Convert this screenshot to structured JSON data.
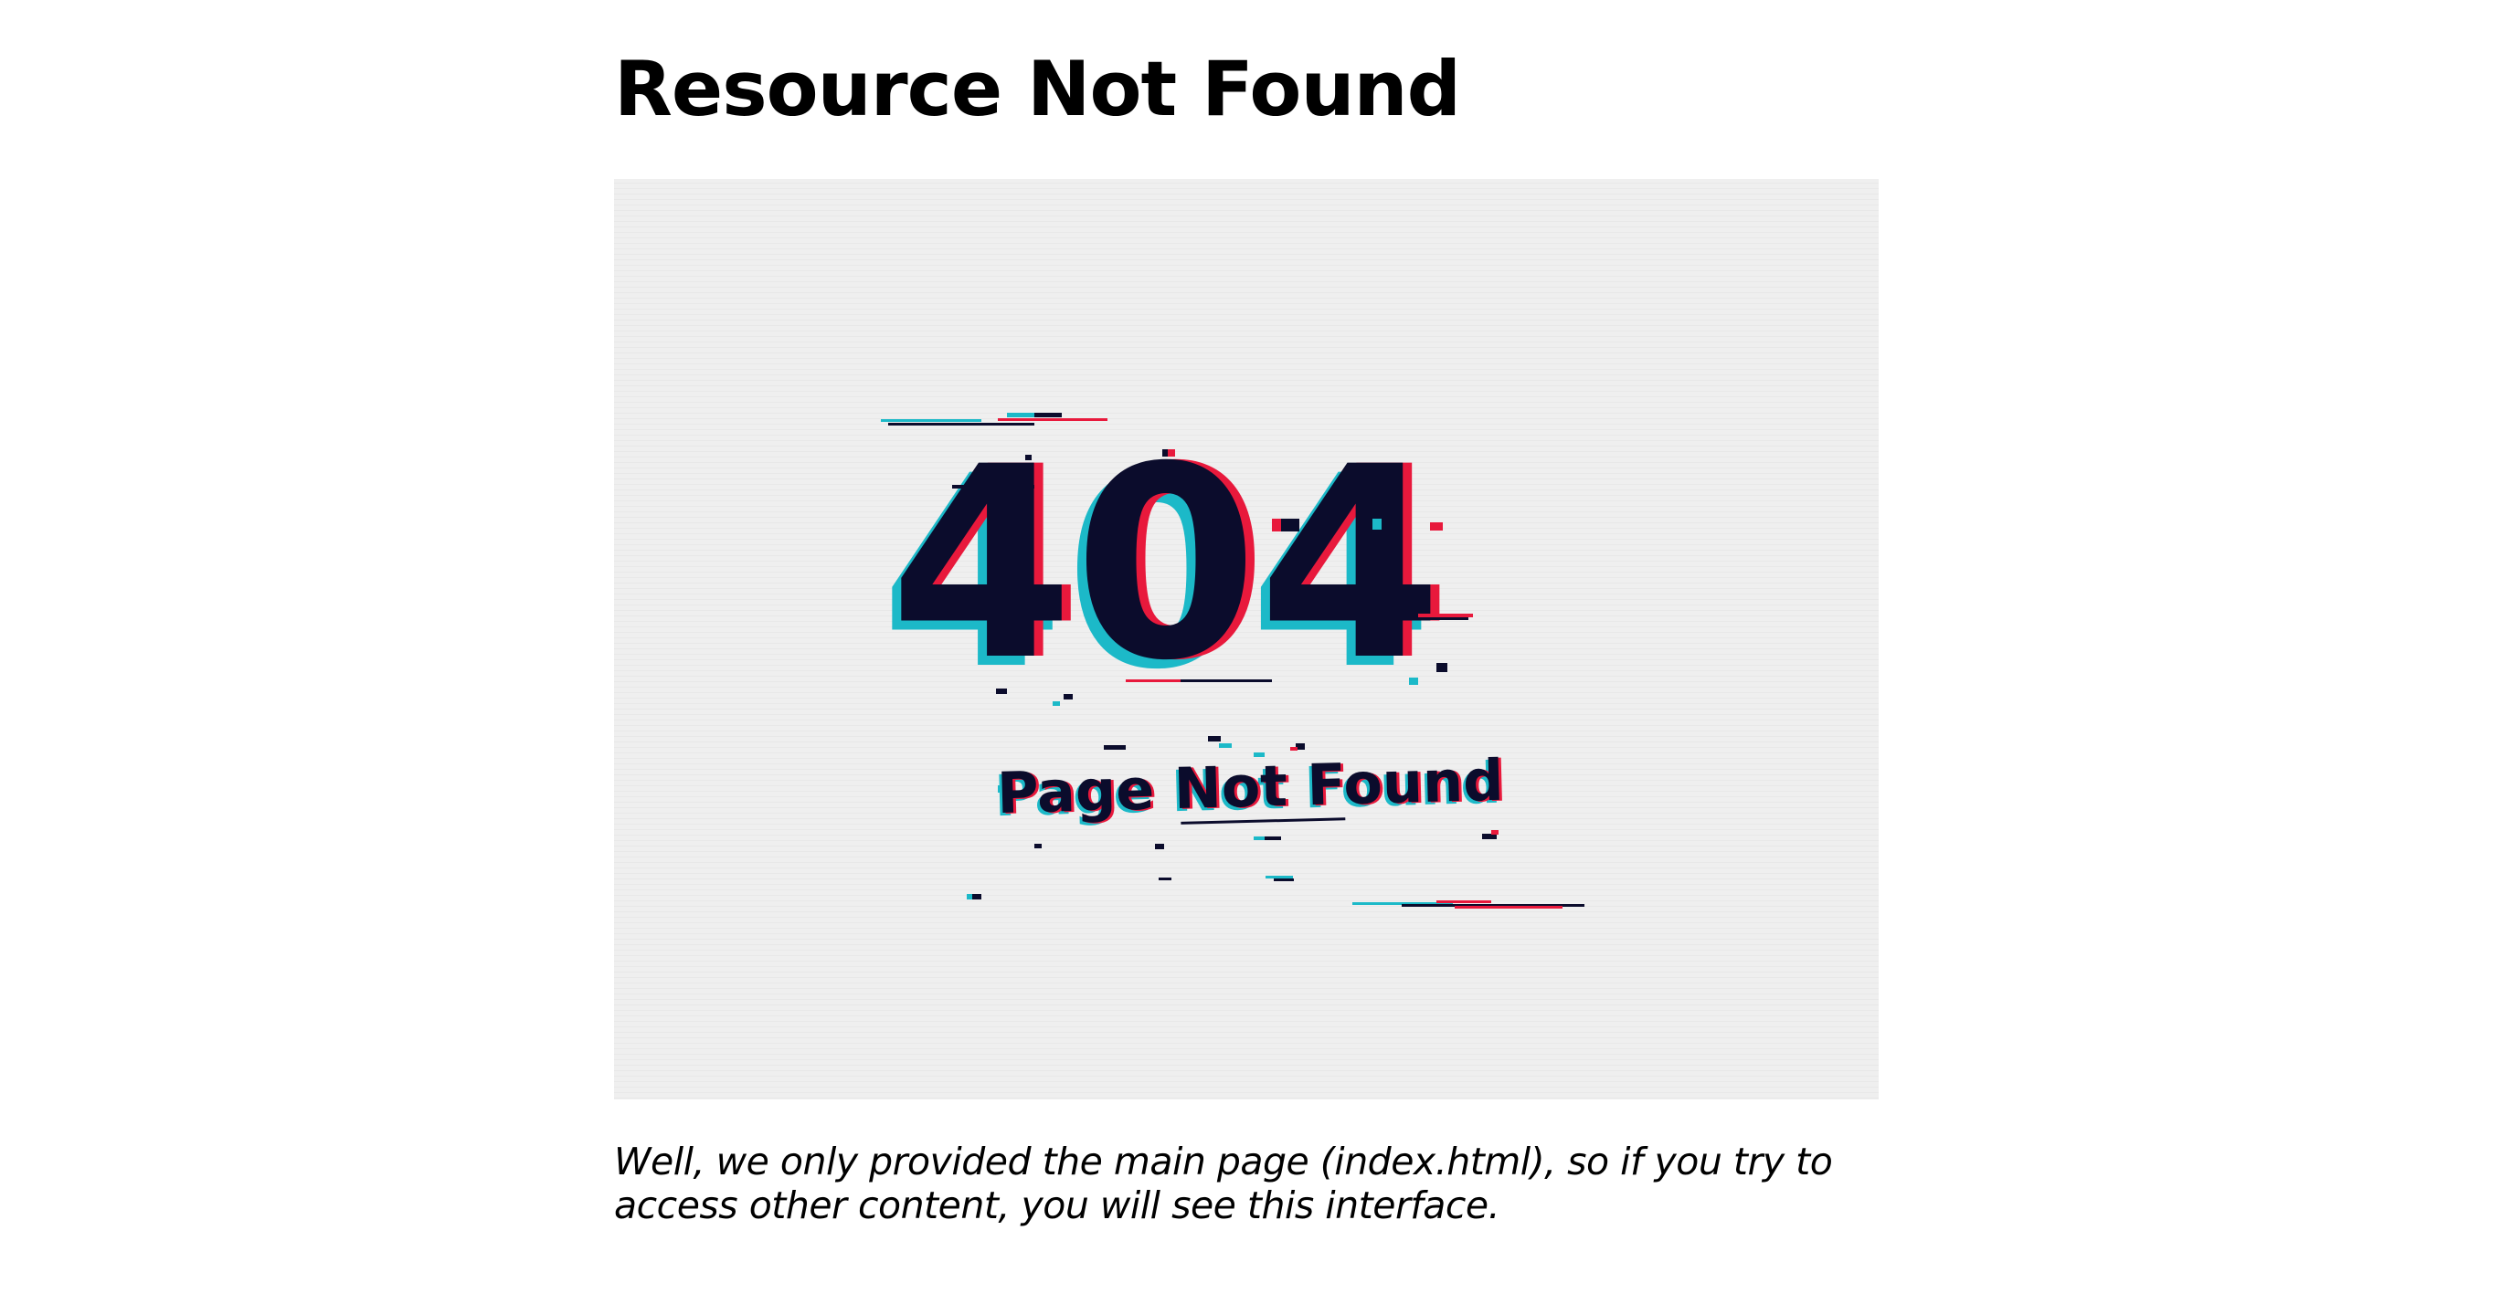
{
  "page": {
    "title": "Resource Not Found",
    "description": "Well, we only provided the main page (index.html), so if you try to access other content, you will see this interface."
  },
  "illustration": {
    "code": "404",
    "message": "Page Not Found",
    "colors": {
      "background": "#efefef",
      "text": "#0b0c2c",
      "glitch_red": "#e8193c",
      "glitch_cyan": "#1cb9c8"
    }
  }
}
